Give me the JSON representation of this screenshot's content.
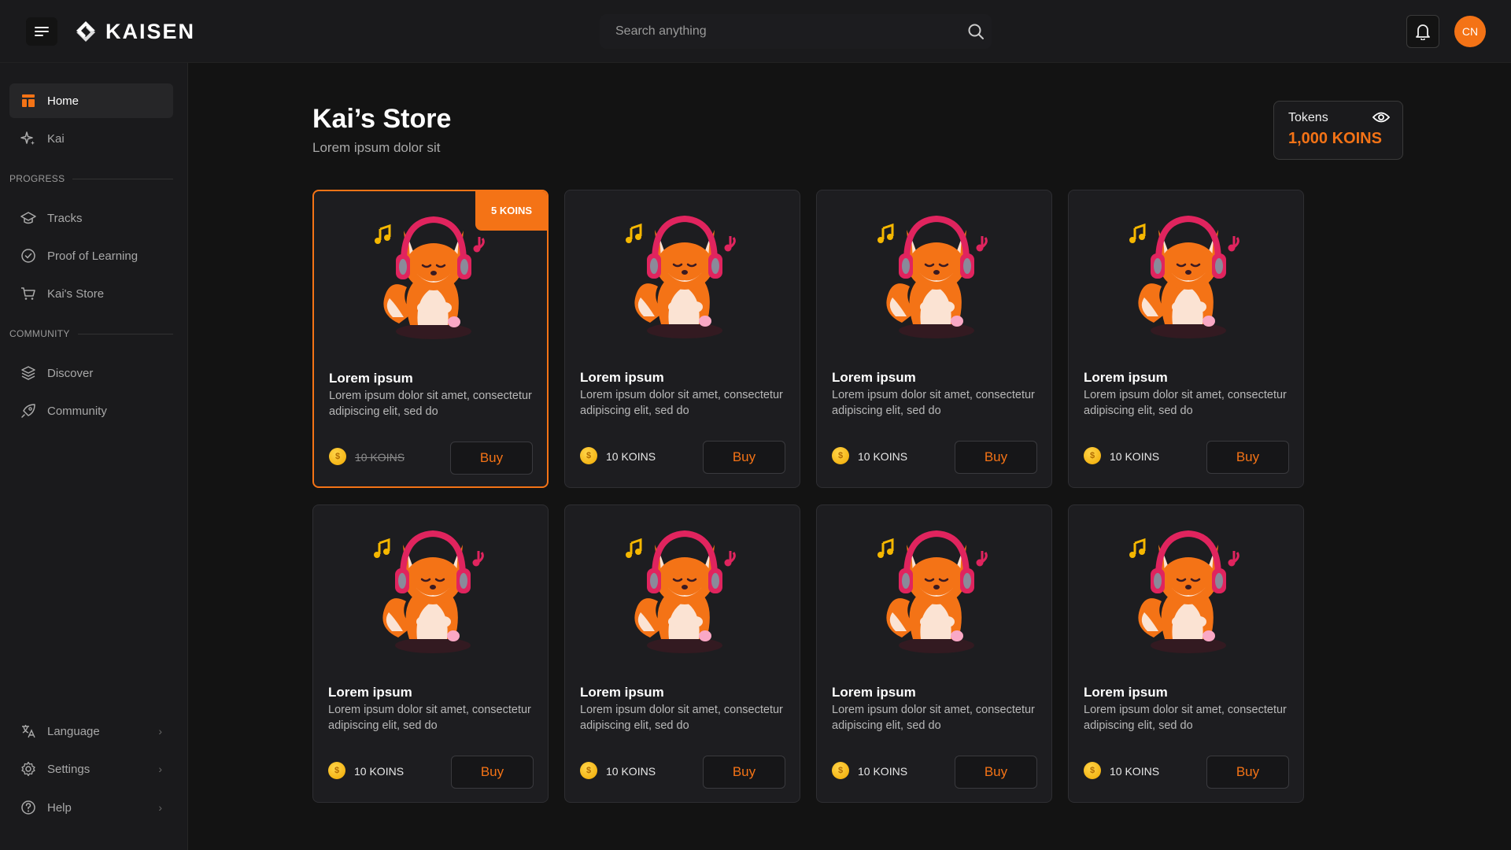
{
  "app": {
    "name": "KAISEN",
    "accent": "#f47316"
  },
  "header": {
    "search_placeholder": "Search anything",
    "avatar_initials": "CN",
    "icons": [
      "menu-icon",
      "search-icon",
      "bell-icon"
    ]
  },
  "sidebar": {
    "items": [
      {
        "label": "Home",
        "icon": "home-icon",
        "active": true
      },
      {
        "label": "Kai",
        "icon": "sparkle-icon"
      }
    ],
    "progress_label": "PROGRESS",
    "progress_items": [
      {
        "label": "Tracks",
        "icon": "graduation-cap-icon"
      },
      {
        "label": "Proof of Learning",
        "icon": "check-circle-icon"
      },
      {
        "label": "Kai's Store",
        "icon": "cart-icon"
      }
    ],
    "community_label": "COMMUNITY",
    "community_items": [
      {
        "label": "Discover",
        "icon": "layers-icon"
      },
      {
        "label": "Community",
        "icon": "rocket-icon"
      }
    ],
    "bottom_items": [
      {
        "label": "Language",
        "icon": "translate-icon"
      },
      {
        "label": "Settings",
        "icon": "gear-icon"
      },
      {
        "label": "Help",
        "icon": "help-circle-icon"
      }
    ]
  },
  "main": {
    "title": "Kai’s Store",
    "subtitle": "Lorem ipsum dolor sit",
    "tokens": {
      "label": "Tokens",
      "value": "1,000 KOINS"
    },
    "products": [
      {
        "name": "Lorem ipsum",
        "desc": "Lorem ipsum dolor sit amet, consectetur adipiscing elit, sed do",
        "price": "10 KOINS",
        "badge": "5 KOINS",
        "featured": true,
        "buy": "Buy"
      },
      {
        "name": "Lorem ipsum",
        "desc": "Lorem ipsum dolor sit amet, consectetur adipiscing elit, sed do",
        "price": "10 KOINS",
        "buy": "Buy"
      },
      {
        "name": "Lorem ipsum",
        "desc": "Lorem ipsum dolor sit amet, consectetur adipiscing elit, sed do",
        "price": "10 KOINS",
        "buy": "Buy"
      },
      {
        "name": "Lorem ipsum",
        "desc": "Lorem ipsum dolor sit amet, consectetur adipiscing elit, sed do",
        "price": "10 KOINS",
        "buy": "Buy"
      },
      {
        "name": "Lorem ipsum",
        "desc": "Lorem ipsum dolor sit amet, consectetur adipiscing elit, sed do",
        "price": "10 KOINS",
        "buy": "Buy"
      },
      {
        "name": "Lorem ipsum",
        "desc": "Lorem ipsum dolor sit amet, consectetur adipiscing elit, sed do",
        "price": "10 KOINS",
        "buy": "Buy"
      },
      {
        "name": "Lorem ipsum",
        "desc": "Lorem ipsum dolor sit amet, consectetur adipiscing elit, sed do",
        "price": "10 KOINS",
        "buy": "Buy"
      },
      {
        "name": "Lorem ipsum",
        "desc": "Lorem ipsum dolor sit amet, consectetur adipiscing elit, sed do",
        "price": "10 KOINS",
        "buy": "Buy"
      }
    ]
  }
}
